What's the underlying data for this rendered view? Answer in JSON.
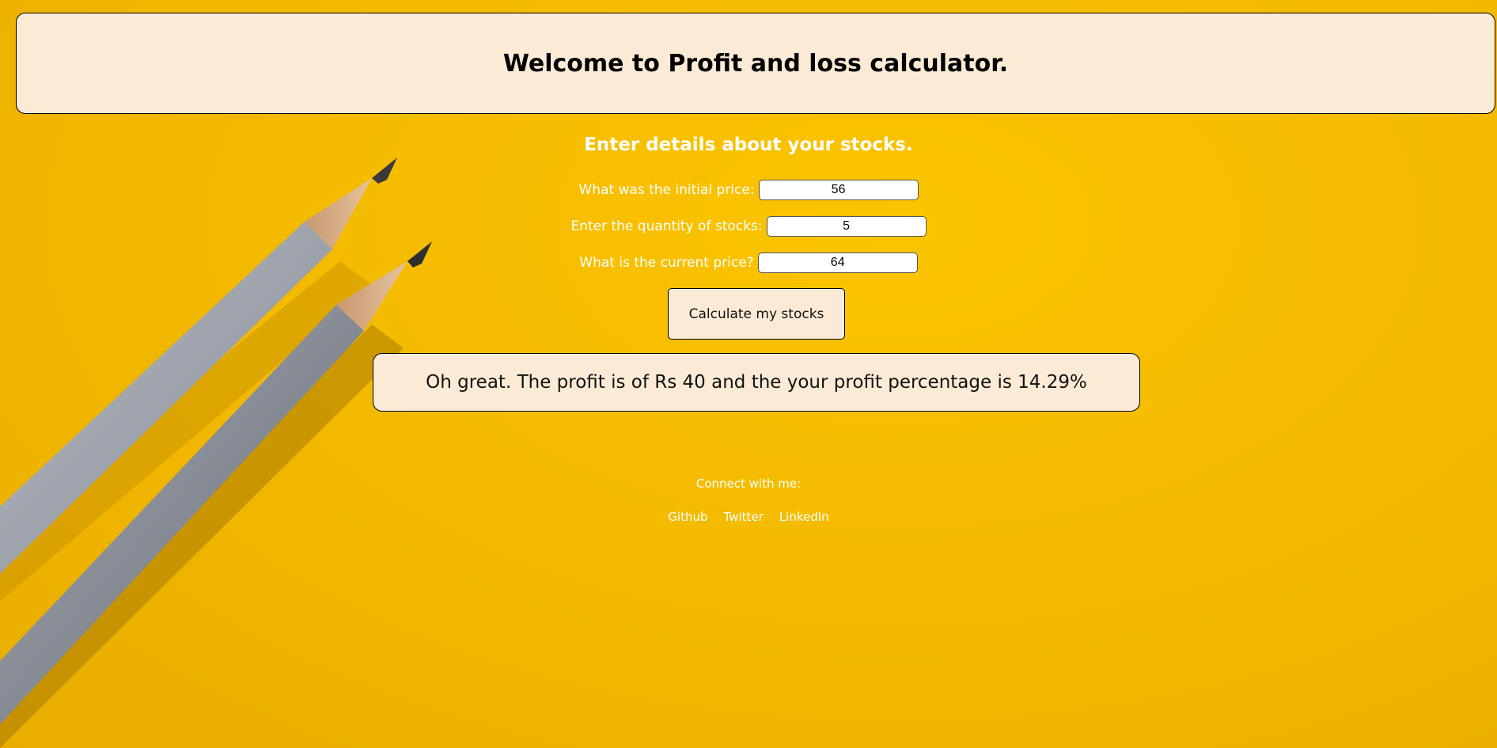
{
  "header": {
    "title": "Welcome to Profit and loss calculator."
  },
  "form": {
    "subtitle": "Enter details about your stocks.",
    "initial_price": {
      "label": "What was the initial price:",
      "value": "56"
    },
    "quantity": {
      "label": "Enter the quantity of stocks:",
      "value": "5"
    },
    "current_price": {
      "label": "What is the current price?",
      "value": "64"
    },
    "button_label": "Calculate my stocks"
  },
  "result": {
    "message": "Oh great. The profit is of Rs 40 and the your profit percentage is 14.29%"
  },
  "footer": {
    "connect_label": "Connect with me:",
    "links": [
      "Github",
      "Twitter",
      "LinkedIn"
    ]
  },
  "background": {
    "image": "yellow-background-with-two-pencils",
    "color": "#f4bb00"
  }
}
